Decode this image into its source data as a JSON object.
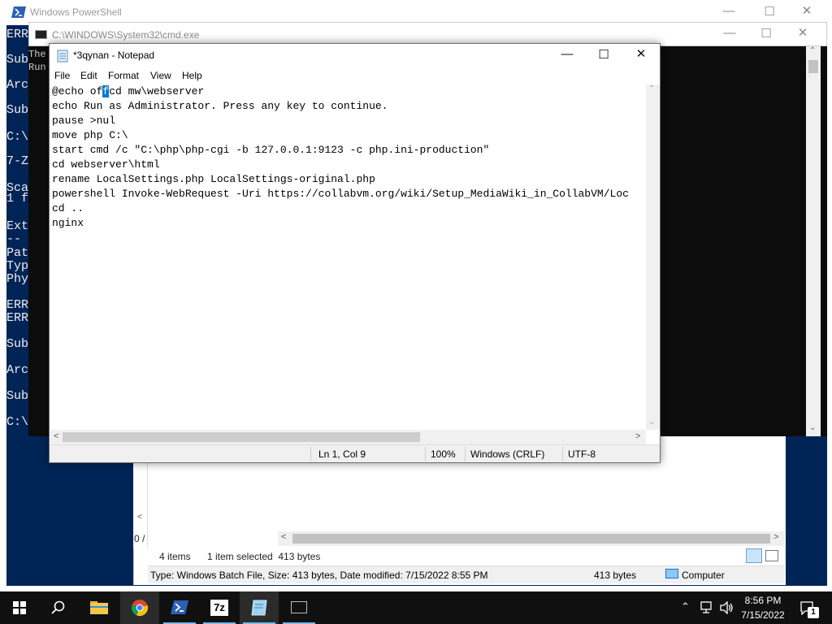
{
  "powershell": {
    "title": "Windows PowerShell",
    "lines": [
      "ERR",
      "Sub",
      "Arc",
      "Sub",
      "C:\\",
      "7-Z",
      "Sca",
      "1 f",
      "Ext",
      "--",
      "Pat",
      "Typ",
      "Phy",
      "ERR",
      "ERR",
      "Sub",
      "Arc",
      "Sub",
      "C:\\"
    ]
  },
  "cmd": {
    "title": "C:\\WINDOWS\\System32\\cmd.exe",
    "lines": [
      "The",
      "Run"
    ]
  },
  "explorer": {
    "items_count": "4 items",
    "selected": "1 item selected  413 bytes",
    "left_label": "0 /",
    "details": "Type: Windows Batch File, Size: 413 bytes, Date modified: 7/15/2022 8:55 PM",
    "details_size": "413 bytes",
    "details_location": "Computer"
  },
  "notepad": {
    "title": "*3qynan - Notepad",
    "menu": [
      "File",
      "Edit",
      "Format",
      "View",
      "Help"
    ],
    "line1_pre": "@echo of",
    "line1_sel": "f",
    "line1_post": "cd mw\\webserver",
    "lines": [
      "echo Run as Administrator. Press any key to continue.",
      "pause >nul",
      "move php C:\\",
      "start cmd /c \"C:\\php\\php-cgi -b 127.0.0.1:9123 -c php.ini-production\"",
      "cd webserver\\html",
      "rename LocalSettings.php LocalSettings-original.php",
      "powershell Invoke-WebRequest -Uri https://collabvm.org/wiki/Setup_MediaWiki_in_CollabVM/Loc",
      "cd ..",
      "nginx"
    ],
    "status": {
      "position": "Ln 1, Col 9",
      "zoom": "100%",
      "line_ending": "Windows (CRLF)",
      "encoding": "UTF-8"
    }
  },
  "taskbar": {
    "time": "8:56 PM",
    "date": "7/15/2022",
    "notification_count": "1",
    "sevenzip_label": "7z"
  },
  "colors": {
    "powershell_bg": "#012456",
    "cmd_bg": "#0c0c0c",
    "taskbar_bg": "#101010",
    "selection": "#0078d7"
  }
}
